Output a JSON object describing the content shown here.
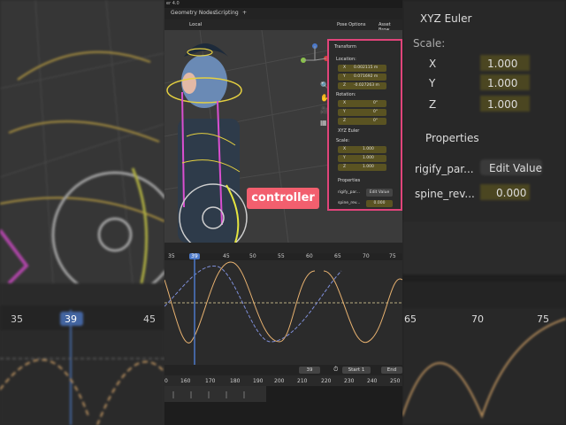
{
  "app": {
    "version_title": "er 4.0",
    "tabs": [
      "Geometry Nodes",
      "Scripting",
      "+"
    ],
    "view_mode": "Local",
    "pose_options": "Pose Options",
    "asset_browser": "Asset Brow"
  },
  "properties": {
    "transform_title": "Transform",
    "location_label": "Location:",
    "location": [
      {
        "axis": "X",
        "value": "0.002115 m"
      },
      {
        "axis": "Y",
        "value": "0.071692 m"
      },
      {
        "axis": "Z",
        "value": "-0.027263 m"
      }
    ],
    "rotation_label": "Rotation:",
    "rotation": [
      {
        "axis": "X",
        "value": "0°"
      },
      {
        "axis": "Y",
        "value": "0°"
      },
      {
        "axis": "Z",
        "value": "0°"
      }
    ],
    "rotation_mode": "XYZ Euler",
    "scale_label": "Scale:",
    "scale": [
      {
        "axis": "X",
        "value": "1.000"
      },
      {
        "axis": "Y",
        "value": "1.000"
      },
      {
        "axis": "Z",
        "value": "1.000"
      }
    ],
    "properties_title": "Properties",
    "rigify_label": "rigify_par...",
    "edit_value": "Edit Value",
    "spine_label": "spine_rev...",
    "spine_value": "0.000"
  },
  "overlay_label": "controller",
  "graph": {
    "ticks": [
      "35",
      "39",
      "45",
      "50",
      "55",
      "60",
      "65",
      "70",
      "75"
    ],
    "current_frame": "39"
  },
  "timeline": {
    "frame": "39",
    "start_label": "Start",
    "start_value": "1",
    "end_label": "End",
    "ruler": [
      "0",
      "160",
      "170",
      "180",
      "190",
      "200",
      "210",
      "220",
      "230",
      "240",
      "250"
    ]
  },
  "right_panel": {
    "rotation_mode": "XYZ Euler",
    "scale_label": "Scale:",
    "scale": [
      {
        "axis": "X",
        "value": "1.000"
      },
      {
        "axis": "Y",
        "value": "1.000"
      },
      {
        "axis": "Z",
        "value": "1.000"
      }
    ],
    "properties_title": "Properties",
    "rigify_label": "rigify_par...",
    "edit_value": "Edit Value",
    "spine_label": "spine_rev...",
    "spine_value": "0.000",
    "graph_ticks": [
      "65",
      "70",
      "75"
    ]
  },
  "left_panel": {
    "graph_ticks": [
      "35",
      "39",
      "45"
    ]
  },
  "colors": {
    "highlight_border": "#e0447a",
    "controller_bg": "#f25f6e",
    "curve_orange": "#e8b270",
    "curve_blue": "#7f8fd9",
    "frame_indicator": "#4c79c9"
  }
}
